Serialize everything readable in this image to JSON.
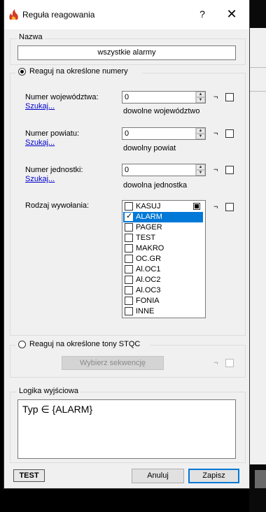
{
  "window": {
    "title": "Reguła reagowania",
    "help_glyph": "?",
    "close_glyph": "✕"
  },
  "nazwa": {
    "group_label": "Nazwa",
    "value": "wszystkie alarmy"
  },
  "numery": {
    "radio_label": "Reaguj na określone numery",
    "negation_glyph": "¬",
    "wojewodztwo": {
      "label": "Numer województwa:",
      "link": "Szukaj...",
      "value": "0",
      "hint": "dowolne województwo"
    },
    "powiat": {
      "label": "Numer powiatu:",
      "link": "Szukaj...",
      "value": "0",
      "hint": "dowolny powiat"
    },
    "jednostka": {
      "label": "Numer jednostki:",
      "link": "Szukaj...",
      "value": "0",
      "hint": "dowolna jednostka"
    },
    "rodzaj": {
      "label": "Rodzaj wywołania:",
      "items": [
        {
          "label": "KASUJ",
          "checked": false,
          "selected": false
        },
        {
          "label": "ALARM",
          "checked": true,
          "selected": true
        },
        {
          "label": "PAGER",
          "checked": false,
          "selected": false
        },
        {
          "label": "TEST",
          "checked": false,
          "selected": false
        },
        {
          "label": "MAKRO",
          "checked": false,
          "selected": false
        },
        {
          "label": "OC.GR",
          "checked": false,
          "selected": false
        },
        {
          "label": "Al.OC1",
          "checked": false,
          "selected": false
        },
        {
          "label": "Al.OC2",
          "checked": false,
          "selected": false
        },
        {
          "label": "Al.OC3",
          "checked": false,
          "selected": false
        },
        {
          "label": "FONIA",
          "checked": false,
          "selected": false
        },
        {
          "label": "INNE",
          "checked": false,
          "selected": false
        }
      ]
    }
  },
  "stqc": {
    "radio_label": "Reaguj na określone tony STQC",
    "button_label": "Wybierz sekwencję",
    "negation_glyph": "¬"
  },
  "logika": {
    "group_label": "Logika wyjściowa",
    "expression": "Typ ∈ {ALARM}"
  },
  "footer": {
    "test_label": "TEST",
    "cancel_label": "Anuluj",
    "save_label": "Zapisz"
  },
  "colors": {
    "selection": "#0078d7",
    "link": "#0000cc",
    "background": "#f0f0f0"
  }
}
